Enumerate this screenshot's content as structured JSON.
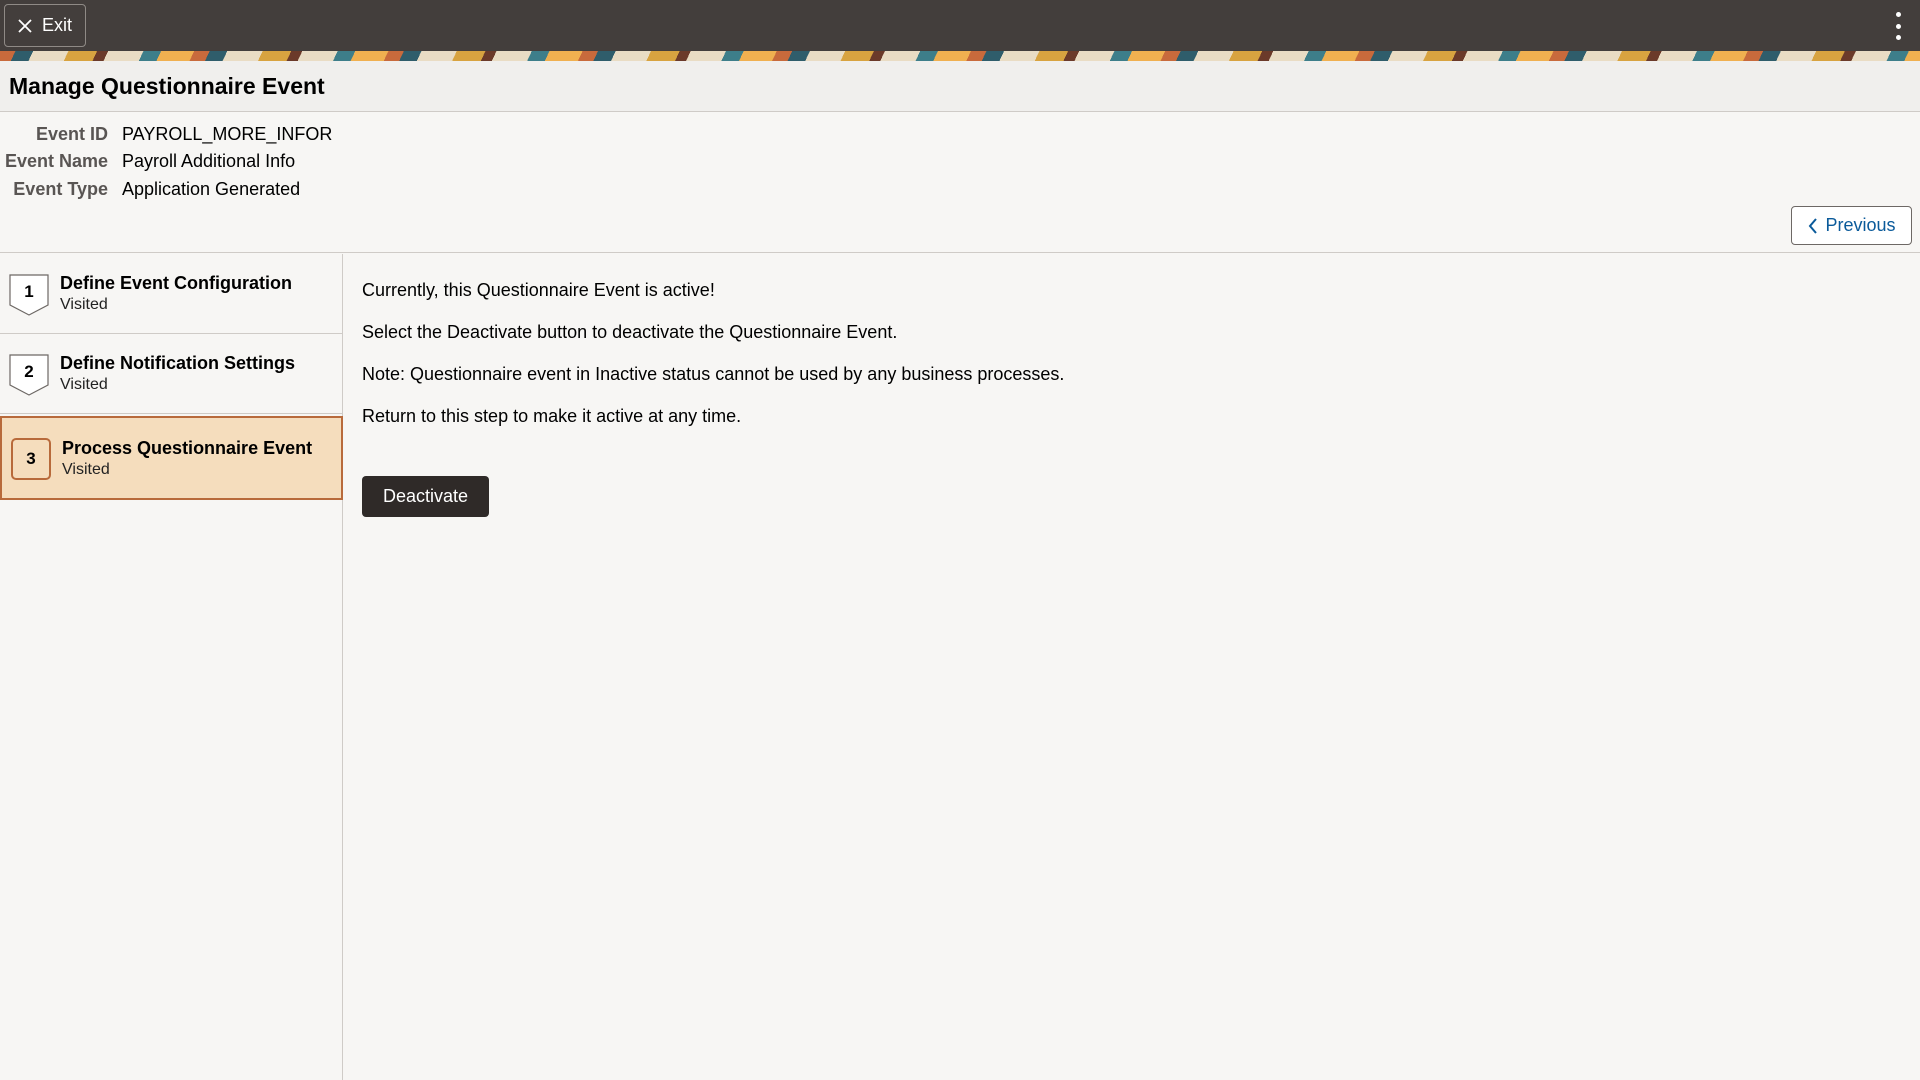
{
  "topbar": {
    "exit_label": "Exit",
    "exit_icon": "close-icon",
    "menu_icon": "kebab-menu-icon"
  },
  "page": {
    "title": "Manage Questionnaire Event"
  },
  "event_info": [
    {
      "label": "Event ID",
      "value": "PAYROLL_MORE_INFOR"
    },
    {
      "label": "Event Name",
      "value": "Payroll Additional Info"
    },
    {
      "label": "Event Type",
      "value": "Application Generated"
    }
  ],
  "navigation": {
    "previous_label": "Previous",
    "previous_icon": "chevron-left-icon"
  },
  "steps": [
    {
      "number": "1",
      "title": "Define Event Configuration",
      "status": "Visited",
      "active": false
    },
    {
      "number": "2",
      "title": "Define Notification Settings",
      "status": "Visited",
      "active": false
    },
    {
      "number": "3",
      "title": "Process Questionnaire Event",
      "status": "Visited",
      "active": true
    }
  ],
  "content": {
    "messages": [
      "Currently, this Questionnaire Event is active!",
      "Select the Deactivate button to deactivate the Questionnaire Event.",
      "Note: Questionnaire event in Inactive status cannot be used by any business processes.",
      "Return to this step to make it active at any time."
    ],
    "deactivate_label": "Deactivate"
  },
  "colors": {
    "topbar": "#433e3c",
    "active_step_bg": "#f5ddbd",
    "active_step_border": "#b86a3b",
    "link_blue": "#0a5a9a",
    "primary_button": "#2f2a28"
  }
}
